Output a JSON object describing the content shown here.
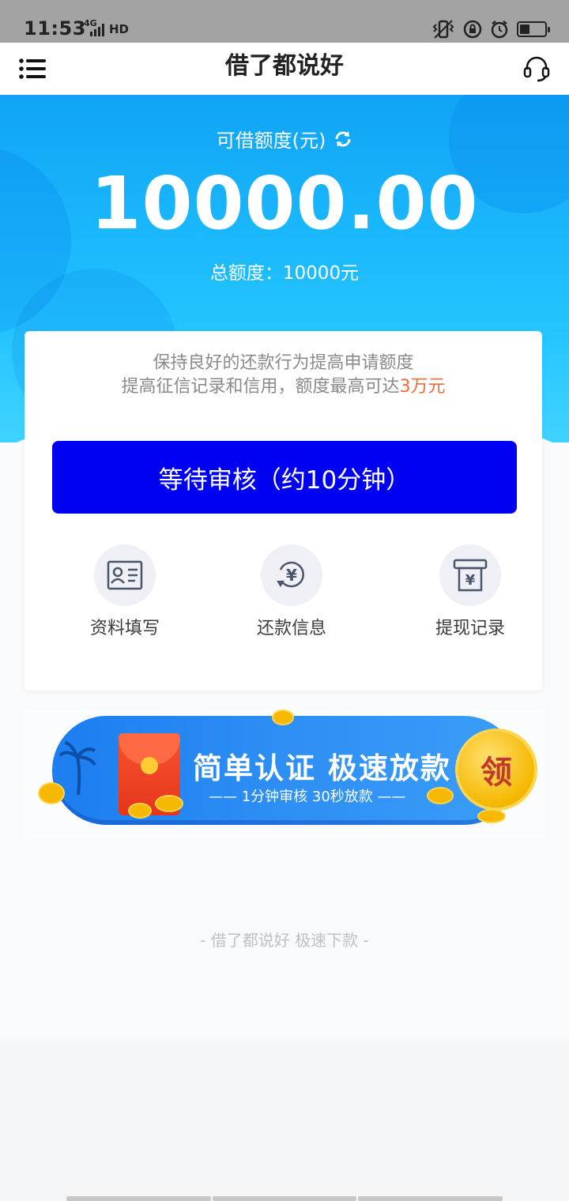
{
  "status_bar": {
    "time": "11:53",
    "network": "4G",
    "hd": "HD",
    "battery_level": 0.4
  },
  "header": {
    "title": "借了都说好"
  },
  "quota": {
    "label": "可借额度(元)",
    "amount": "10000.00",
    "total": "总额度：10000元"
  },
  "card": {
    "tip_line1": "保持良好的还款行为提高申请额度",
    "tip_line2": "提高征信记录和信用，额度最高可达",
    "tip_highlight": "3万元",
    "main_button": "等待审核（约10分钟）",
    "actions": [
      {
        "label": "资料填写",
        "icon": "id-card-icon"
      },
      {
        "label": "还款信息",
        "icon": "yuan-refresh-icon"
      },
      {
        "label": "提现记录",
        "icon": "atm-yuan-icon"
      }
    ]
  },
  "banner": {
    "title": "简单认证  极速放款",
    "subtitle": "—— 1分钟审核  30秒放款 ——",
    "coin_label": "领"
  },
  "footer": {
    "note": "- 借了都说好  极速下款 -"
  },
  "colors": {
    "primary_button": "#0000f2",
    "highlight": "#f26b3a",
    "hero_blue": "#1aa8f7"
  }
}
